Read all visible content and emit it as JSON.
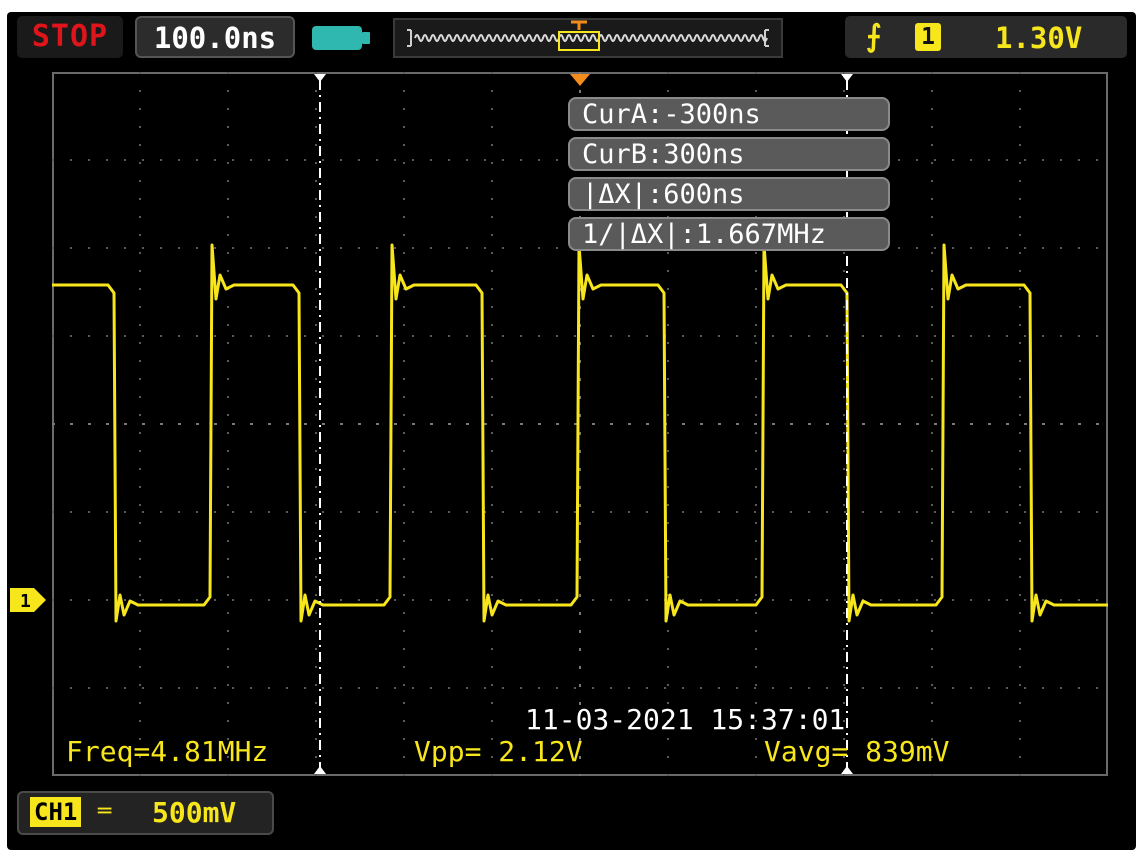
{
  "status": {
    "run_state": "STOP",
    "timebase": "100.0ns"
  },
  "trigger": {
    "edge_symbol": "⨍",
    "source": "1",
    "level": "1.30V"
  },
  "cursors": {
    "cur_a": "CurA:-300ns",
    "cur_b": "CurB:300ns",
    "delta_x": "|ΔX|:600ns",
    "inv_delta_x": "1/|ΔX|:1.667MHz"
  },
  "timestamp": "11-03-2021 15:37:01",
  "measurements": {
    "freq": "Freq=4.81MHz",
    "vpp": "Vpp= 2.12V",
    "vavg": "Vavg= 839mV"
  },
  "channel": {
    "label": "CH1",
    "marker": "1",
    "coupling_symbol": "═",
    "scale": "500mV"
  },
  "colors": {
    "trace": "#f7e61c",
    "stop": "#e0141b",
    "battery": "#2fb8b0",
    "cursor_line": "#ffffff",
    "trigger_marker": "#f28c1c"
  }
}
